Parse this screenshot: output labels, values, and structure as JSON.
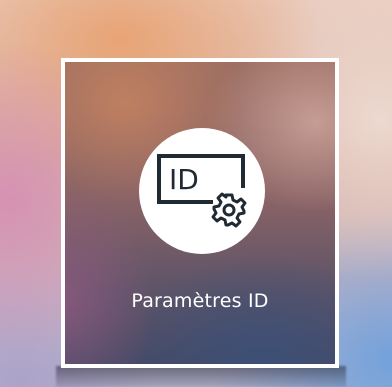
{
  "menu_tile": {
    "label": "Paramètres ID",
    "icon": "id-settings-icon",
    "icon_text": "ID",
    "selected": true
  },
  "colors": {
    "tile_border": "#ffffff",
    "icon_background": "#ffffff",
    "icon_foreground": "#1f2a33",
    "label": "#ffffff"
  }
}
